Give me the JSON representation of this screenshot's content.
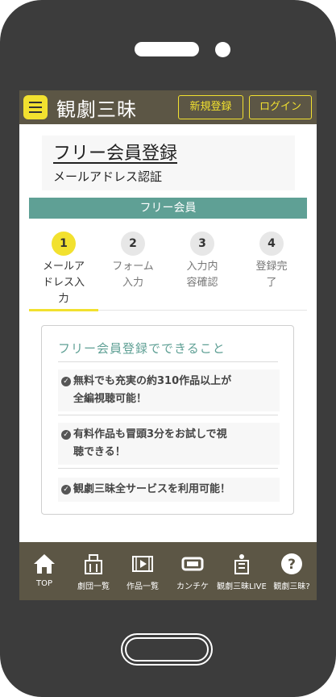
{
  "header": {
    "logo_text": "観劇三昧",
    "register_label": "新規登録",
    "login_label": "ログイン"
  },
  "page": {
    "title": "フリー会員登録",
    "subtitle": "メールアドレス認証",
    "banner": "フリー会員"
  },
  "steps": [
    {
      "num": "1",
      "line1": "メールア",
      "line2": "ドレス入",
      "line3": "力",
      "active": true
    },
    {
      "num": "2",
      "line1": "フォーム",
      "line2": "入力",
      "line3": ""
    },
    {
      "num": "3",
      "line1": "入力内",
      "line2": "容確認",
      "line3": ""
    },
    {
      "num": "4",
      "line1": "登録完",
      "line2": "了",
      "line3": ""
    }
  ],
  "card": {
    "title": "フリー会員登録でできること",
    "benefits": [
      {
        "line1": "無料でも充実の約310作品以上が",
        "line2": "全編視聴可能！"
      },
      {
        "line1": "有料作品も冒頭3分をお試しで視",
        "line2": "聴できる！"
      },
      {
        "line1": "観劇三昧全サービスを利用可能！",
        "line2": ""
      }
    ]
  },
  "tabbar": [
    {
      "label": "TOP",
      "icon": "home-icon"
    },
    {
      "label": "劇団一覧",
      "icon": "theater-company-icon"
    },
    {
      "label": "作品一覧",
      "icon": "film-icon"
    },
    {
      "label": "カンチケ",
      "icon": "ticket-icon"
    },
    {
      "label": "観劇三昧LIVE",
      "icon": "live-icon"
    },
    {
      "label": "観劇三昧?",
      "icon": "help-icon"
    }
  ],
  "colors": {
    "accent_yellow": "#f2e12f",
    "header_brown": "#5c5645",
    "teal": "#5fa095",
    "phone_frame": "#3c3c3c"
  }
}
